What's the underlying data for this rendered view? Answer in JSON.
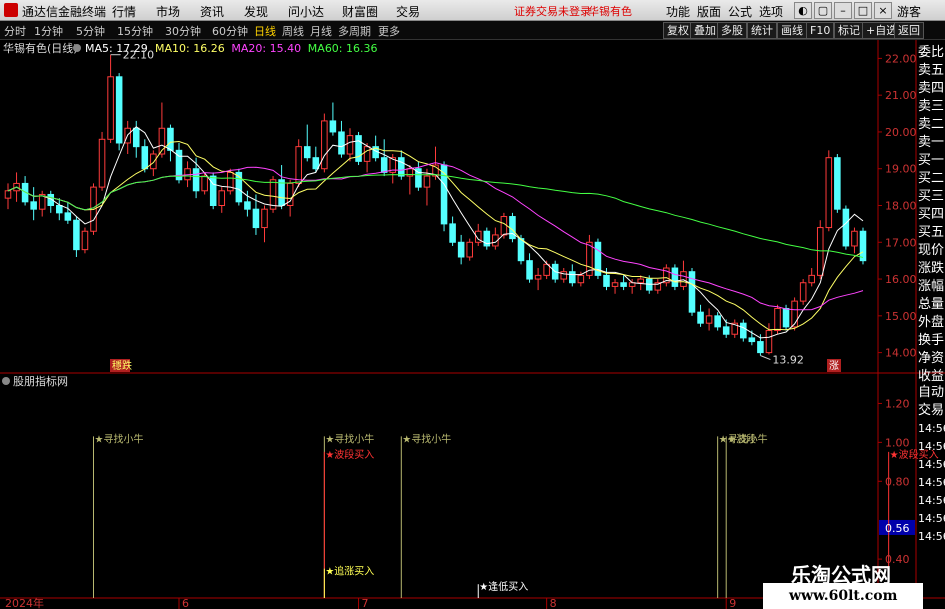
{
  "app": {
    "title": "通达信金融终端",
    "menus": [
      "行情",
      "市场",
      "资讯",
      "发现",
      "问小达",
      "财富圈",
      "交易"
    ],
    "alert": "证券交易未登录",
    "stock_tag": "华锡有色",
    "right_menus": [
      "功能",
      "版面",
      "公式",
      "选项"
    ],
    "user": "游客"
  },
  "periods": [
    "分时",
    "1分钟",
    "5分钟",
    "15分钟",
    "30分钟",
    "60分钟",
    "日线",
    "周线",
    "月线",
    "多周期",
    "更多"
  ],
  "active_period": "日线",
  "toolbar": [
    "复权",
    "叠加",
    "多股",
    "统计",
    "画线",
    "F10",
    "标记",
    "+自选",
    "返回"
  ],
  "side_labels": [
    "委比",
    "卖五",
    "卖四",
    "卖三",
    "卖二",
    "卖一",
    "买一",
    "买二",
    "买三",
    "买四",
    "买五",
    "现价",
    "涨跌",
    "涨幅",
    "总量",
    "外盘",
    "换手",
    "净资",
    "收益"
  ],
  "side_labels2": [
    "自动",
    "交易",
    "14:56",
    "14:56",
    "14:56",
    "14:56",
    "14:56",
    "14:56",
    "14:56"
  ],
  "watermark": {
    "name": "乐淘公式网",
    "url": "www.60lt.com"
  },
  "chart_data": [
    {
      "type": "candlestick",
      "title": "华锡有色(日线)",
      "ma_legend": [
        {
          "name": "MA5",
          "value": "17.29",
          "color": "#ffffff"
        },
        {
          "name": "MA10",
          "value": "16.26",
          "color": "#ffff66"
        },
        {
          "name": "MA20",
          "value": "15.40",
          "color": "#ff44ff"
        },
        {
          "name": "MA60",
          "value": "16.36",
          "color": "#44ff44"
        }
      ],
      "ylim": [
        13.5,
        22.5
      ],
      "yticks": [
        "22.00",
        "21.00",
        "20.00",
        "19.00",
        "18.00",
        "17.00",
        "16.00",
        "15.00",
        "14.00"
      ],
      "x_month_labels": [
        "2024年",
        "6",
        "7",
        "8",
        "9"
      ],
      "high_annotation": "22.10",
      "low_annotation": "13.92",
      "tag_left": "穩跌",
      "tag_right": "涨",
      "candles": [
        [
          18.2,
          18.6,
          17.9,
          18.4
        ],
        [
          18.4,
          18.9,
          18.1,
          18.6
        ],
        [
          18.6,
          18.8,
          18.0,
          18.1
        ],
        [
          18.1,
          18.5,
          17.6,
          17.9
        ],
        [
          17.9,
          18.4,
          17.7,
          18.3
        ],
        [
          18.3,
          18.4,
          17.8,
          18.0
        ],
        [
          18.0,
          18.2,
          17.6,
          17.8
        ],
        [
          17.8,
          18.1,
          17.5,
          17.6
        ],
        [
          17.6,
          17.7,
          16.6,
          16.8
        ],
        [
          16.8,
          17.4,
          16.7,
          17.3
        ],
        [
          17.3,
          18.6,
          17.2,
          18.5
        ],
        [
          18.5,
          20.0,
          18.4,
          19.8
        ],
        [
          19.8,
          22.1,
          19.7,
          21.5
        ],
        [
          21.5,
          21.6,
          19.5,
          19.7
        ],
        [
          19.7,
          20.3,
          19.4,
          20.1
        ],
        [
          20.1,
          20.3,
          19.3,
          19.6
        ],
        [
          19.6,
          19.8,
          18.9,
          19.0
        ],
        [
          19.0,
          19.5,
          18.8,
          19.4
        ],
        [
          19.4,
          20.8,
          19.3,
          20.1
        ],
        [
          20.1,
          20.2,
          19.2,
          19.5
        ],
        [
          19.5,
          19.7,
          18.6,
          18.7
        ],
        [
          18.7,
          19.2,
          18.5,
          19.0
        ],
        [
          19.0,
          19.3,
          18.2,
          18.4
        ],
        [
          18.4,
          18.9,
          18.3,
          18.8
        ],
        [
          18.8,
          18.9,
          17.9,
          18.0
        ],
        [
          18.0,
          18.5,
          17.8,
          18.4
        ],
        [
          18.4,
          19.0,
          18.3,
          18.9
        ],
        [
          18.9,
          19.0,
          18.0,
          18.1
        ],
        [
          18.1,
          18.4,
          17.7,
          17.9
        ],
        [
          17.9,
          18.3,
          17.2,
          17.4
        ],
        [
          17.4,
          18.0,
          17.0,
          17.9
        ],
        [
          17.9,
          18.8,
          17.8,
          18.7
        ],
        [
          18.7,
          19.1,
          17.9,
          18.0
        ],
        [
          18.0,
          18.7,
          17.7,
          18.6
        ],
        [
          18.6,
          19.8,
          18.5,
          19.6
        ],
        [
          19.6,
          20.2,
          19.2,
          19.3
        ],
        [
          19.3,
          19.6,
          18.9,
          19.0
        ],
        [
          19.0,
          20.5,
          18.9,
          20.3
        ],
        [
          20.3,
          20.8,
          19.9,
          20.0
        ],
        [
          20.0,
          20.3,
          19.3,
          19.4
        ],
        [
          19.4,
          20.1,
          19.2,
          19.9
        ],
        [
          19.9,
          20.0,
          19.1,
          19.2
        ],
        [
          19.2,
          19.7,
          18.9,
          19.6
        ],
        [
          19.6,
          19.9,
          19.2,
          19.3
        ],
        [
          19.3,
          19.8,
          18.8,
          18.9
        ],
        [
          18.9,
          19.4,
          18.6,
          19.3
        ],
        [
          19.3,
          19.5,
          18.7,
          18.8
        ],
        [
          18.8,
          19.1,
          18.3,
          19.0
        ],
        [
          19.0,
          19.2,
          18.4,
          18.5
        ],
        [
          18.5,
          19.0,
          18.0,
          18.8
        ],
        [
          18.8,
          19.6,
          18.7,
          19.1
        ],
        [
          19.1,
          19.2,
          17.3,
          17.5
        ],
        [
          17.5,
          17.7,
          16.9,
          17.0
        ],
        [
          17.0,
          17.2,
          16.4,
          16.6
        ],
        [
          16.6,
          17.1,
          16.5,
          17.0
        ],
        [
          17.0,
          17.5,
          16.9,
          17.3
        ],
        [
          17.3,
          17.4,
          16.8,
          16.9
        ],
        [
          16.9,
          17.4,
          16.8,
          17.2
        ],
        [
          17.2,
          17.8,
          17.1,
          17.7
        ],
        [
          17.7,
          17.8,
          17.0,
          17.1
        ],
        [
          17.1,
          17.2,
          16.4,
          16.5
        ],
        [
          16.5,
          16.7,
          15.9,
          16.0
        ],
        [
          16.0,
          16.3,
          15.7,
          16.1
        ],
        [
          16.1,
          16.5,
          16.0,
          16.4
        ],
        [
          16.4,
          16.5,
          15.9,
          16.0
        ],
        [
          16.0,
          16.3,
          15.9,
          16.2
        ],
        [
          16.2,
          16.4,
          15.8,
          15.9
        ],
        [
          15.9,
          16.2,
          15.8,
          16.1
        ],
        [
          16.1,
          17.2,
          16.0,
          17.0
        ],
        [
          17.0,
          17.1,
          16.0,
          16.1
        ],
        [
          16.1,
          16.3,
          15.7,
          15.8
        ],
        [
          15.8,
          16.0,
          15.6,
          15.9
        ],
        [
          15.9,
          16.1,
          15.7,
          15.8
        ],
        [
          15.8,
          16.0,
          15.6,
          15.9
        ],
        [
          15.9,
          16.1,
          15.7,
          16.0
        ],
        [
          16.0,
          16.1,
          15.6,
          15.7
        ],
        [
          15.7,
          16.0,
          15.6,
          15.9
        ],
        [
          15.9,
          16.4,
          15.8,
          16.3
        ],
        [
          16.3,
          16.4,
          15.7,
          15.8
        ],
        [
          15.8,
          16.5,
          15.7,
          16.2
        ],
        [
          16.2,
          16.3,
          15.0,
          15.1
        ],
        [
          15.1,
          15.3,
          14.7,
          14.8
        ],
        [
          14.8,
          15.2,
          14.6,
          15.0
        ],
        [
          15.0,
          15.1,
          14.6,
          14.7
        ],
        [
          14.7,
          14.9,
          14.4,
          14.5
        ],
        [
          14.5,
          14.9,
          14.4,
          14.8
        ],
        [
          14.8,
          14.9,
          14.3,
          14.4
        ],
        [
          14.4,
          14.6,
          14.2,
          14.3
        ],
        [
          14.3,
          14.5,
          13.92,
          14.0
        ],
        [
          14.0,
          14.8,
          13.95,
          14.6
        ],
        [
          14.6,
          15.3,
          14.5,
          15.2
        ],
        [
          15.2,
          15.3,
          14.6,
          14.7
        ],
        [
          14.7,
          15.5,
          14.6,
          15.4
        ],
        [
          15.4,
          16.0,
          15.3,
          15.9
        ],
        [
          15.9,
          16.3,
          15.8,
          16.1
        ],
        [
          16.1,
          17.6,
          16.0,
          17.4
        ],
        [
          17.4,
          19.5,
          17.3,
          19.3
        ],
        [
          19.3,
          19.4,
          17.8,
          17.9
        ],
        [
          17.9,
          18.0,
          16.8,
          16.9
        ],
        [
          16.9,
          17.4,
          16.7,
          17.3
        ],
        [
          17.3,
          17.4,
          16.4,
          16.5
        ]
      ]
    },
    {
      "type": "signal",
      "title": "股朋指标网",
      "yticks": [
        "1.20",
        "1.00",
        "0.80",
        "0.56",
        "0.40"
      ],
      "current_value": "0.56",
      "ylim": [
        0.2,
        1.3
      ],
      "signals": [
        {
          "index": 10,
          "text": "★寻找小牛",
          "color": "#b8b870",
          "level": 1.0
        },
        {
          "index": 37,
          "text": "★寻找小牛",
          "color": "#b8b870",
          "level": 1.0
        },
        {
          "index": 37,
          "text": "★波段买入",
          "color": "#ff3333",
          "level": 0.92
        },
        {
          "index": 37,
          "text": "★追涨买入",
          "color": "#ffff55",
          "level": 0.32
        },
        {
          "index": 46,
          "text": "★寻找小牛",
          "color": "#b8b870",
          "level": 1.0
        },
        {
          "index": 55,
          "text": "★逢低买入",
          "color": "#ffffff",
          "level": 0.24
        },
        {
          "index": 83,
          "text": "★寻找小牛",
          "color": "#b8b870",
          "level": 1.0
        },
        {
          "index": 84,
          "text": "★波段",
          "color": "#b8b870",
          "level": 1.0
        },
        {
          "index": 103,
          "text": "★波段买入",
          "color": "#ff3333",
          "level": 0.92
        }
      ]
    }
  ]
}
